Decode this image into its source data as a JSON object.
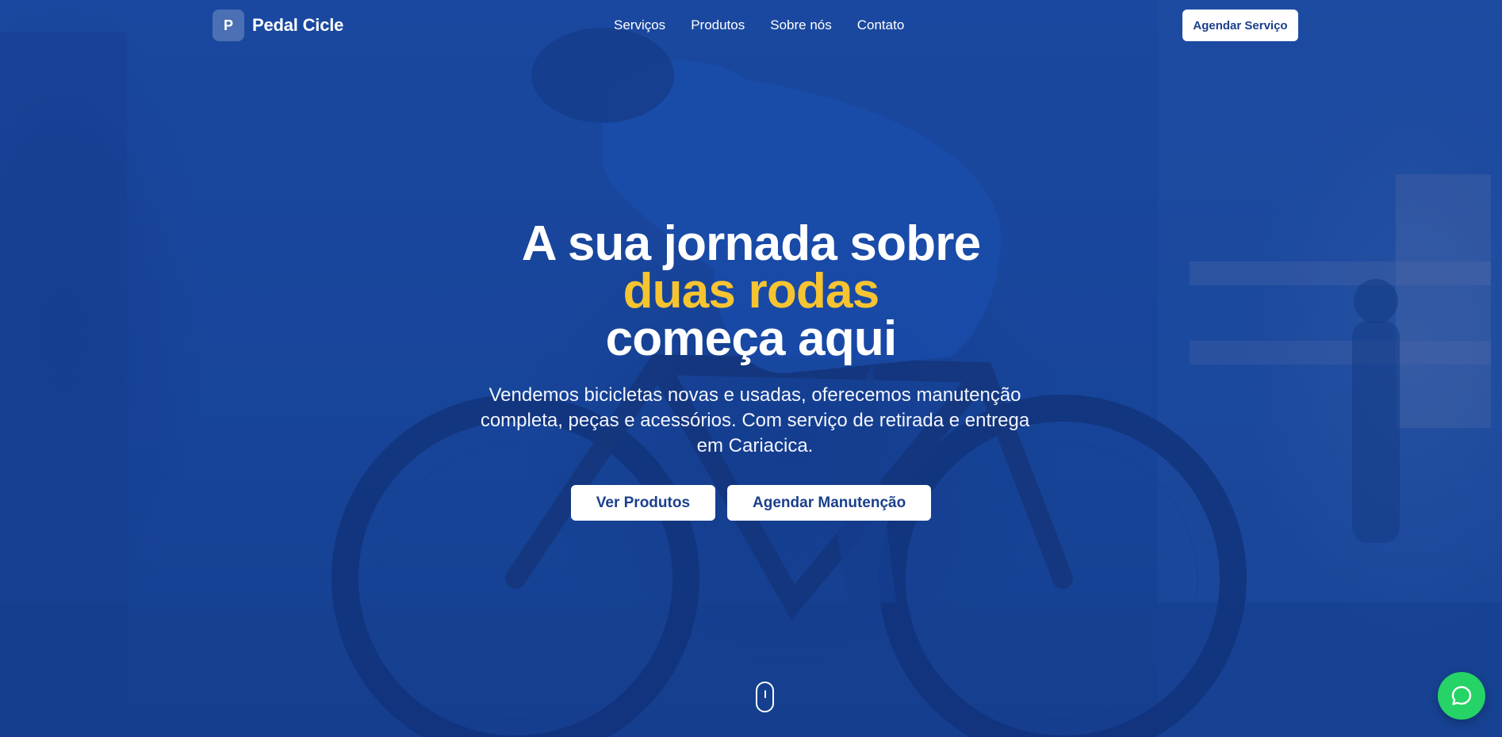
{
  "brand": {
    "badge": "P",
    "name": "Pedal Cicle"
  },
  "nav": {
    "links": [
      "Serviços",
      "Produtos",
      "Sobre nós",
      "Contato"
    ],
    "cta": "Agendar Serviço"
  },
  "hero": {
    "headline_line1": "A sua jornada sobre",
    "headline_accent": "duas rodas",
    "headline_line3": "começa aqui",
    "subtitle": "Vendemos bicicletas novas e usadas, oferecemos manutenção completa, peças e acessórios. Com serviço de retirada e entrega em Cariacica.",
    "primary_button": "Ver Produtos",
    "secondary_button": "Agendar Manutenção"
  },
  "icons": {
    "scroll": "mouse-scroll-icon",
    "chat": "whatsapp-chat-icon"
  },
  "colors": {
    "overlay": "#1e4fa6",
    "accent": "#f6c431",
    "button_text": "#1b3f8c",
    "chat": "#25d366"
  }
}
